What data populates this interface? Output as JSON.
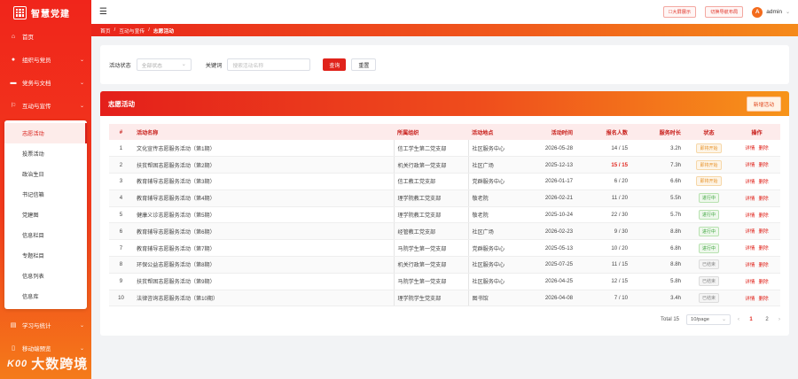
{
  "app": {
    "title": "智慧党建"
  },
  "sidebar": {
    "items": [
      {
        "label": "首页",
        "icon": "home-icon",
        "glyph": "⌂"
      },
      {
        "label": "组织与党员",
        "icon": "user-icon",
        "glyph": "●"
      },
      {
        "label": "党务与文档",
        "icon": "folder-icon",
        "glyph": "▬"
      },
      {
        "label": "互动与宣传",
        "icon": "share-icon",
        "glyph": "⚐"
      }
    ],
    "submenu": [
      "志愿活动",
      "投票活动",
      "政治生日",
      "书记信箱",
      "党建图",
      "信息栏目",
      "专题栏目",
      "信息列表",
      "信息库"
    ],
    "bottom_items": [
      {
        "label": "学习与统计",
        "icon": "chart-icon",
        "glyph": "▤"
      },
      {
        "label": "移动端预览",
        "icon": "mobile-icon",
        "glyph": "▯"
      }
    ]
  },
  "topbar": {
    "btn_fullscreen": "☐大屏展示",
    "btn_guide": "切换导航布局",
    "avatar_letter": "A",
    "username": "admin"
  },
  "breadcrumb": [
    "首页",
    "互动与宣传",
    "志愿活动"
  ],
  "filter": {
    "status_label": "活动状态",
    "status_placeholder": "全部状态",
    "keyword_label": "关键词",
    "keyword_placeholder": "搜索活动名称",
    "search_btn": "查询",
    "reset_btn": "重置"
  },
  "table_card": {
    "title": "志愿活动",
    "new_btn": "新增活动",
    "columns": [
      "#",
      "活动名称",
      "所属组织",
      "活动地点",
      "活动时间",
      "报名人数",
      "服务时长",
      "状态",
      "操作"
    ],
    "rows": [
      {
        "idx": "1",
        "name": "文化宣传志愿服务活动（第1期）",
        "org": "信工学生第二党支部",
        "loc": "社区服务中心",
        "time": "2026-05-28",
        "count": "14 / 15",
        "full": false,
        "hours": "3.2h",
        "status": "即将开始",
        "status_type": "pending"
      },
      {
        "idx": "2",
        "name": "扶贫帮困志愿服务活动（第2期）",
        "org": "机关行政第一党支部",
        "loc": "社区广场",
        "time": "2025-12-13",
        "count": "15 / 15",
        "full": true,
        "hours": "7.3h",
        "status": "即将开始",
        "status_type": "pending"
      },
      {
        "idx": "3",
        "name": "教育辅导志愿服务活动（第3期）",
        "org": "信工教工党支部",
        "loc": "党群服务中心",
        "time": "2026-01-17",
        "count": "6 / 20",
        "full": false,
        "hours": "6.6h",
        "status": "即将开始",
        "status_type": "pending"
      },
      {
        "idx": "4",
        "name": "教育辅导志愿服务活动（第4期）",
        "org": "理学院教工党支部",
        "loc": "敬老院",
        "time": "2026-02-21",
        "count": "11 / 20",
        "full": false,
        "hours": "5.5h",
        "status": "进行中",
        "status_type": "ongoing"
      },
      {
        "idx": "5",
        "name": "健康义诊志愿服务活动（第5期）",
        "org": "理学院教工党支部",
        "loc": "敬老院",
        "time": "2025-10-24",
        "count": "22 / 30",
        "full": false,
        "hours": "5.7h",
        "status": "进行中",
        "status_type": "ongoing"
      },
      {
        "idx": "6",
        "name": "教育辅导志愿服务活动（第6期）",
        "org": "经管教工党支部",
        "loc": "社区广场",
        "time": "2026-02-23",
        "count": "9 / 30",
        "full": false,
        "hours": "8.8h",
        "status": "进行中",
        "status_type": "ongoing"
      },
      {
        "idx": "7",
        "name": "教育辅导志愿服务活动（第7期）",
        "org": "马院学生第一党支部",
        "loc": "党群服务中心",
        "time": "2025-05-13",
        "count": "10 / 20",
        "full": false,
        "hours": "6.8h",
        "status": "进行中",
        "status_type": "ongoing"
      },
      {
        "idx": "8",
        "name": "环保公益志愿服务活动（第8期）",
        "org": "机关行政第一党支部",
        "loc": "社区服务中心",
        "time": "2025-07-25",
        "count": "11 / 15",
        "full": false,
        "hours": "8.8h",
        "status": "已结束",
        "status_type": "ended"
      },
      {
        "idx": "9",
        "name": "扶贫帮困志愿服务活动（第9期）",
        "org": "马院学生第一党支部",
        "loc": "社区服务中心",
        "time": "2026-04-25",
        "count": "12 / 15",
        "full": false,
        "hours": "5.8h",
        "status": "已结束",
        "status_type": "ended"
      },
      {
        "idx": "10",
        "name": "法律咨询志愿服务活动（第10期）",
        "org": "理学院学生党支部",
        "loc": "图书馆",
        "time": "2026-04-08",
        "count": "7 / 10",
        "full": false,
        "hours": "3.4h",
        "status": "已结束",
        "status_type": "ended"
      }
    ],
    "op_detail": "详情",
    "op_delete": "删除"
  },
  "pagination": {
    "total": "Total 15",
    "page_size": "10/page",
    "pages": [
      "1",
      "2"
    ],
    "current": "1"
  },
  "watermark": {
    "text": "大数跨境",
    "logo_text": "K00"
  },
  "colors": {
    "primary_red": "#e0231b",
    "accent_orange": "#f5891a",
    "pending": "#e8932a",
    "ongoing": "#3aa23a",
    "ended": "#888888"
  }
}
